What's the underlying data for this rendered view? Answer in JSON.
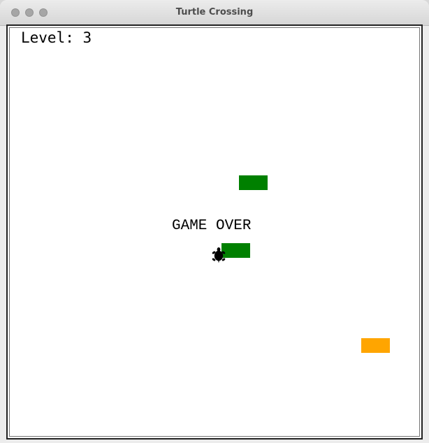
{
  "window": {
    "title": "Turtle Crossing"
  },
  "hud": {
    "level_text": "Level: 3"
  },
  "game": {
    "status_text": "GAME OVER",
    "cars": [
      {
        "name": "car-green-top",
        "color": "#008000"
      },
      {
        "name": "car-green-middle",
        "color": "#008000"
      },
      {
        "name": "car-orange-bottom",
        "color": "#ffa500"
      }
    ],
    "player": {
      "icon": "turtle-icon",
      "color": "#000000"
    }
  }
}
